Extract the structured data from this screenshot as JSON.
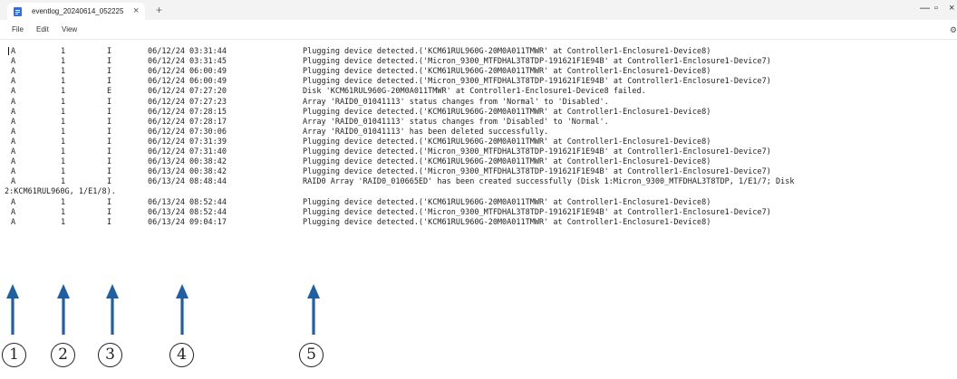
{
  "tab": {
    "title": "eventlog_20240614_052225",
    "close_glyph": "×",
    "new_tab_glyph": "+"
  },
  "window": {
    "minimize_glyph": "—",
    "maximize_glyph": "▫",
    "close_glyph": "×"
  },
  "menu": {
    "file": "File",
    "edit": "Edit",
    "view": "View"
  },
  "accent_color": "#2f6fd6",
  "arrow_color": "#1f5fa6",
  "log_lines": [
    {
      "a": "A",
      "b": "1",
      "c": "I",
      "time": "06/12/24 03:31:44",
      "msg": "Plugging device detected.('KCM61RUL960G-20M0A011TMWR' at Controller1-Enclosure1-Device8)"
    },
    {
      "a": "A",
      "b": "1",
      "c": "I",
      "time": "06/12/24 03:31:45",
      "msg": "Plugging device detected.('Micron_9300_MTFDHAL3T8TDP-191621F1E94B' at Controller1-Enclosure1-Device7)"
    },
    {
      "a": "A",
      "b": "1",
      "c": "I",
      "time": "06/12/24 06:00:49",
      "msg": "Plugging device detected.('KCM61RUL960G-20M0A011TMWR' at Controller1-Enclosure1-Device8)"
    },
    {
      "a": "A",
      "b": "1",
      "c": "I",
      "time": "06/12/24 06:00:49",
      "msg": "Plugging device detected.('Micron_9300_MTFDHAL3T8TDP-191621F1E94B' at Controller1-Enclosure1-Device7)"
    },
    {
      "a": "A",
      "b": "1",
      "c": "E",
      "time": "06/12/24 07:27:20",
      "msg": "Disk 'KCM61RUL960G-20M0A011TMWR' at Controller1-Enclosure1-Device8 failed."
    },
    {
      "a": "A",
      "b": "1",
      "c": "I",
      "time": "06/12/24 07:27:23",
      "msg": "Array 'RAID0_01041113' status changes from 'Normal' to 'Disabled'."
    },
    {
      "a": "A",
      "b": "1",
      "c": "I",
      "time": "06/12/24 07:28:15",
      "msg": "Plugging device detected.('KCM61RUL960G-20M0A011TMWR' at Controller1-Enclosure1-Device8)"
    },
    {
      "a": "A",
      "b": "1",
      "c": "I",
      "time": "06/12/24 07:28:17",
      "msg": "Array 'RAID0_01041113' status changes from 'Disabled' to 'Normal'."
    },
    {
      "a": "A",
      "b": "1",
      "c": "I",
      "time": "06/12/24 07:30:06",
      "msg": "Array 'RAID0_01041113' has been deleted successfully."
    },
    {
      "a": "A",
      "b": "1",
      "c": "I",
      "time": "06/12/24 07:31:39",
      "msg": "Plugging device detected.('KCM61RUL960G-20M0A011TMWR' at Controller1-Enclosure1-Device8)"
    },
    {
      "a": "A",
      "b": "1",
      "c": "I",
      "time": "06/12/24 07:31:40",
      "msg": "Plugging device detected.('Micron_9300_MTFDHAL3T8TDP-191621F1E94B' at Controller1-Enclosure1-Device7)"
    },
    {
      "a": "A",
      "b": "1",
      "c": "I",
      "time": "06/13/24 00:38:42",
      "msg": "Plugging device detected.('KCM61RUL960G-20M0A011TMWR' at Controller1-Enclosure1-Device8)"
    },
    {
      "a": "A",
      "b": "1",
      "c": "I",
      "time": "06/13/24 00:38:42",
      "msg": "Plugging device detected.('Micron_9300_MTFDHAL3T8TDP-191621F1E94B' at Controller1-Enclosure1-Device7)"
    },
    {
      "a": "A",
      "b": "1",
      "c": "I",
      "time": "06/13/24 08:48:44",
      "msg": "RAID0 Array 'RAID0_010665ED' has been created successfully (Disk 1:Micron_9300_MTFDHAL3T8TDP, 1/E1/7; Disk"
    },
    {
      "wrap": "2:KCM61RUL960G, 1/E1/8)."
    },
    {
      "a": "A",
      "b": "1",
      "c": "I",
      "time": "06/13/24 08:52:44",
      "msg": "Plugging device detected.('KCM61RUL960G-20M0A011TMWR' at Controller1-Enclosure1-Device8)"
    },
    {
      "a": "A",
      "b": "1",
      "c": "I",
      "time": "06/13/24 08:52:44",
      "msg": "Plugging device detected.('Micron_9300_MTFDHAL3T8TDP-191621F1E94B' at Controller1-Enclosure1-Device7)"
    },
    {
      "a": "A",
      "b": "1",
      "c": "I",
      "time": "06/13/24 09:04:17",
      "msg": "Plugging device detected.('KCM61RUL960G-20M0A011TMWR' at Controller1-Enclosure1-Device8)"
    }
  ],
  "annotations": [
    "①",
    "②",
    "③",
    "④",
    "⑤"
  ]
}
